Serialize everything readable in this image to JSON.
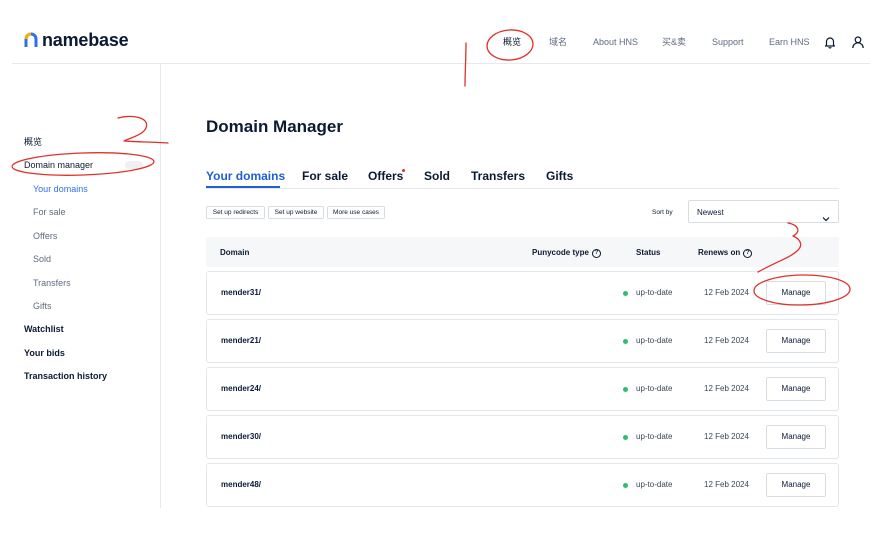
{
  "brand": {
    "name": "namebase",
    "accent": "#1f5fd1",
    "logo_colors": [
      "#2f6fea",
      "#f5b300"
    ]
  },
  "topnav": [
    {
      "label": "概览",
      "active": true
    },
    {
      "label": "域名",
      "active": false
    },
    {
      "label": "About HNS",
      "active": false
    },
    {
      "label": "买&卖",
      "active": false
    },
    {
      "label": "Support",
      "active": false
    },
    {
      "label": "Earn HNS",
      "active": false
    }
  ],
  "header_icons": [
    "bell-icon",
    "user-icon"
  ],
  "sidebar": {
    "overview": "概览",
    "domain_manager": "Domain manager",
    "sub_items": [
      "Your domains",
      "For sale",
      "Offers",
      "Sold",
      "Transfers",
      "Gifts"
    ],
    "watchlist": "Watchlist",
    "your_bids": "Your bids",
    "transaction_history": "Transaction history"
  },
  "main": {
    "title": "Domain Manager",
    "tabs": [
      "Your domains",
      "For sale",
      "Offers",
      "Sold",
      "Transfers",
      "Gifts"
    ],
    "active_tab": "Your domains",
    "chips": [
      "Set up redirects",
      "Set up website",
      "More use cases"
    ],
    "sort_label": "Sort by",
    "sort_value": "Newest",
    "columns": {
      "domain": "Domain",
      "punycode": "Punycode type",
      "status": "Status",
      "renews": "Renews on",
      "help_glyph": "?"
    },
    "rows": [
      {
        "domain": "mender31/",
        "status": "up-to-date",
        "renews": "12 Feb 2024",
        "action": "Manage"
      },
      {
        "domain": "mender21/",
        "status": "up-to-date",
        "renews": "12 Feb 2024",
        "action": "Manage"
      },
      {
        "domain": "mender24/",
        "status": "up-to-date",
        "renews": "12 Feb 2024",
        "action": "Manage"
      },
      {
        "domain": "mender30/",
        "status": "up-to-date",
        "renews": "12 Feb 2024",
        "action": "Manage"
      },
      {
        "domain": "mender48/",
        "status": "up-to-date",
        "renews": "12 Feb 2024",
        "action": "Manage"
      }
    ]
  },
  "annotations": {
    "numbers": [
      "1",
      "2",
      "3"
    ],
    "color": "#e0312b"
  }
}
